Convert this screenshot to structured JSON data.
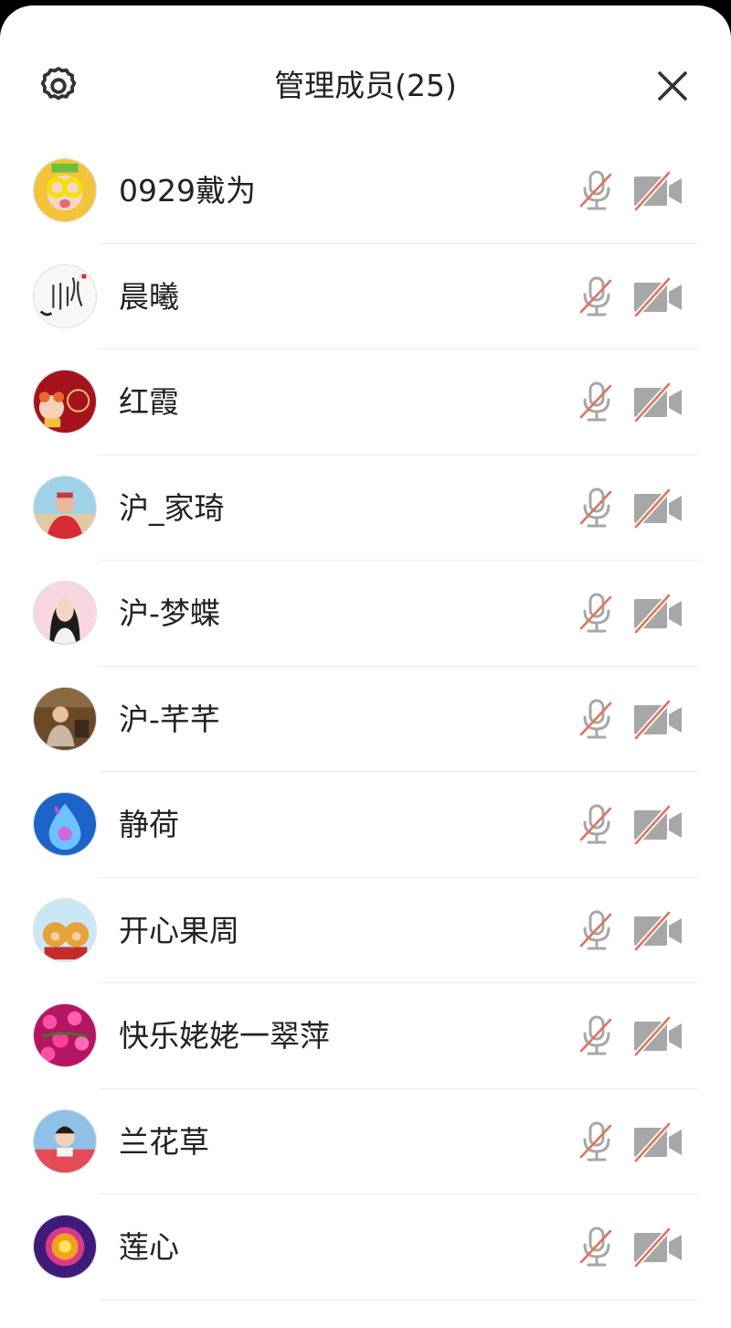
{
  "header": {
    "title": "管理成员(25)",
    "settings_icon": "gear-icon",
    "close_icon": "close-icon"
  },
  "members": [
    {
      "name": "0929戴为",
      "avatar": "yellow"
    },
    {
      "name": "晨曦",
      "avatar": "calligraphy"
    },
    {
      "name": "红霞",
      "avatar": "red"
    },
    {
      "name": "沪_家琦",
      "avatar": "beach"
    },
    {
      "name": "沪-梦蝶",
      "avatar": "pink"
    },
    {
      "name": "沪-芊芊",
      "avatar": "brown"
    },
    {
      "name": "静荷",
      "avatar": "blue"
    },
    {
      "name": "开心果周",
      "avatar": "bears"
    },
    {
      "name": "快乐姥姥一翠萍",
      "avatar": "flowers"
    },
    {
      "name": "兰花草",
      "avatar": "child"
    },
    {
      "name": "莲心",
      "avatar": "purple"
    }
  ],
  "colors": {
    "icon_gray": "#a7a7a7",
    "mute_slash": "#e0735e",
    "text": "#222222",
    "divider": "#ececec"
  },
  "row_icons": {
    "mic": "mic-muted-icon",
    "camera": "camera-off-icon"
  }
}
